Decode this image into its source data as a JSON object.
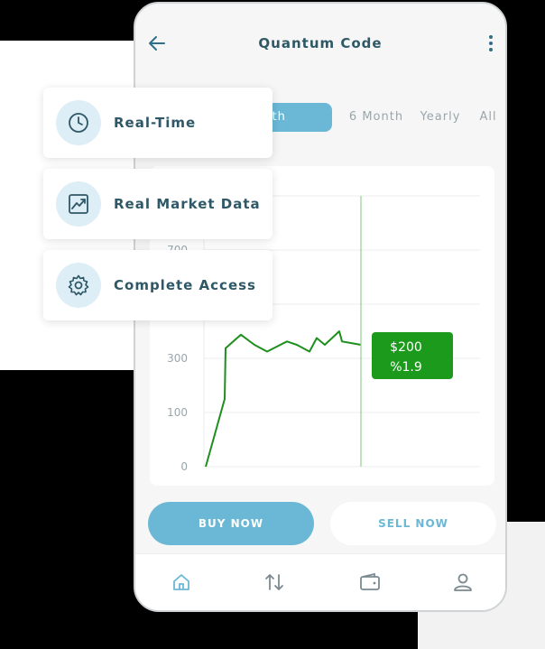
{
  "app": {
    "title": "Quantum Code"
  },
  "range_tabs": [
    {
      "label": "Month",
      "active": true
    },
    {
      "label": "6 Month",
      "active": false
    },
    {
      "label": "Yearly",
      "active": false
    },
    {
      "label": "All",
      "active": false
    }
  ],
  "chart_data": {
    "type": "line",
    "y_ticks": [
      0,
      100,
      300,
      700
    ],
    "values": [
      0,
      150,
      375,
      475,
      400,
      350,
      425,
      400,
      350,
      450,
      400,
      500,
      425,
      400
    ],
    "tooltip": {
      "price": "$200",
      "change": "%1.9"
    },
    "grid": true,
    "colors": {
      "line": "#1e8f1e",
      "tooltip_bg": "#1c9a1c",
      "marker_line": "#8fd08f"
    }
  },
  "actions": {
    "buy": "BUY NOW",
    "sell": "SELL NOW"
  },
  "bottom_nav": [
    {
      "icon": "home-icon"
    },
    {
      "icon": "transfer-icon"
    },
    {
      "icon": "wallet-icon"
    },
    {
      "icon": "profile-icon"
    }
  ],
  "features": [
    {
      "label": "Real-Time",
      "icon": "clock-icon"
    },
    {
      "label": "Real Market Data",
      "icon": "chart-trend-icon"
    },
    {
      "label": "Complete Access",
      "icon": "gear-icon"
    }
  ],
  "colors": {
    "accent": "#6bb8d6",
    "title": "#2f5867",
    "muted": "#9aa6ab"
  }
}
